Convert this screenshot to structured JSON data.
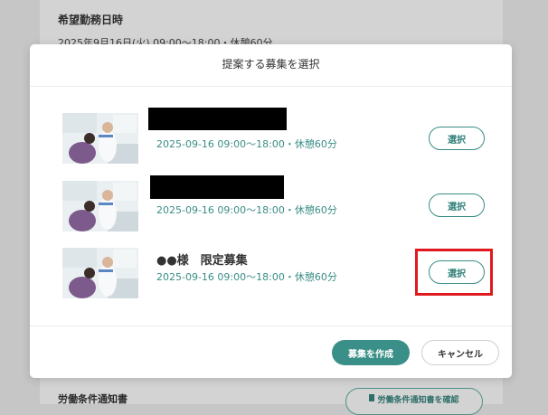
{
  "background": {
    "heading": "希望勤務日時",
    "date_line": "2025年9月16日(火) 09:00〜18:00・休憩60分",
    "footer_label": "労働条件通知書",
    "footer_button": "労働条件通知書を確認"
  },
  "modal": {
    "title": "提案する募集を選択",
    "items": [
      {
        "title": "",
        "date": "2025-09-16 09:00〜18:00・休憩60分",
        "select_label": "選択"
      },
      {
        "title": "",
        "date": "2025-09-16 09:00〜18:00・休憩60分",
        "select_label": "選択"
      },
      {
        "title": "●●様　限定募集",
        "date": "2025-09-16 09:00〜18:00・休憩60分",
        "select_label": "選択"
      }
    ],
    "create_label": "募集を作成",
    "cancel_label": "キャンセル"
  },
  "colors": {
    "accent": "#3a9088",
    "highlight": "#e0191f"
  }
}
